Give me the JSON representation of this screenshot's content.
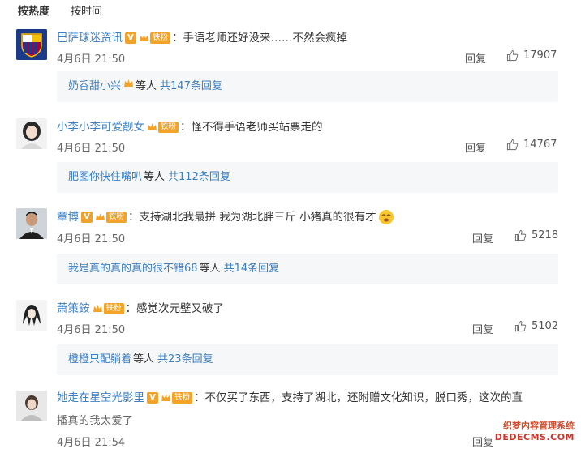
{
  "sort": {
    "hot": "按热度",
    "time": "按时间"
  },
  "comments": [
    {
      "user": "巴萨球迷资讯",
      "verified": true,
      "fan_badge": "铁粉",
      "text": "手语老师还好没来……不然会疯掉",
      "time": "4月6日 21:50",
      "reply_label": "回复",
      "likes": "17907",
      "sub_user": "奶香甜小兴",
      "sub_etc": "等人",
      "sub_count": "共147条回复"
    },
    {
      "user": "小李小李可爱靓女",
      "verified": false,
      "fan_badge": "铁粉",
      "text": "怪不得手语老师买站票走的",
      "time": "4月6日 21:50",
      "reply_label": "回复",
      "likes": "14767",
      "sub_user": "肥图你快住嘴叭",
      "sub_etc": "等人",
      "sub_count": "共112条回复"
    },
    {
      "user": "章博",
      "verified": true,
      "fan_badge": "铁粉",
      "text": "支持湖北我最拼 我为湖北胖三斤 小猪真的很有才",
      "time": "4月6日 21:50",
      "reply_label": "回复",
      "likes": "5218",
      "sub_user": "我是真的真的真的很不错68",
      "sub_etc": "等人",
      "sub_count": "共14条回复"
    },
    {
      "user": "萧策銨",
      "verified": false,
      "fan_badge": "铁粉",
      "text": "感觉次元壁又破了",
      "time": "4月6日 21:50",
      "reply_label": "回复",
      "likes": "5102",
      "sub_user": "橙橙只配躺着",
      "sub_etc": "等人",
      "sub_count": "共23条回复"
    },
    {
      "user": "她走在星空光影里",
      "verified": true,
      "fan_badge": "铁粉",
      "text": "不仅买了东西，支持了湖北，还附赠文化知识，脱口秀，这次的直",
      "text_line2": "播真的我太爱了",
      "time": "4月6日 21:54",
      "reply_label": "回复"
    }
  ],
  "watermark": {
    "line1": "织梦内容管理系统",
    "line2": "DEDECMS.COM"
  },
  "colors": {
    "link": "#3c7fc2",
    "badge": "#f3a328",
    "subbox_bg": "#f6f7f9"
  }
}
